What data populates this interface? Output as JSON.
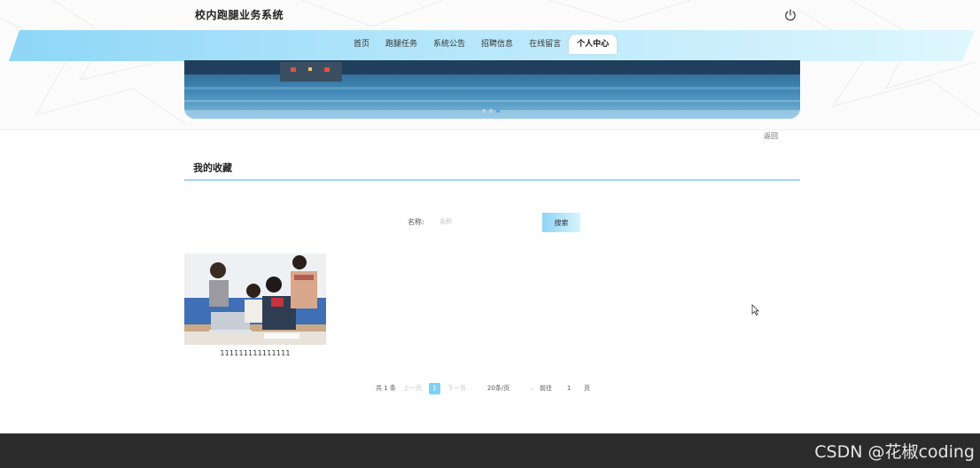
{
  "header": {
    "site_title": "校内跑腿业务系统",
    "power_icon": "power-icon"
  },
  "nav": {
    "items": [
      {
        "label": "首页"
      },
      {
        "label": "跑腿任务"
      },
      {
        "label": "系统公告"
      },
      {
        "label": "招聘信息"
      },
      {
        "label": "在线留言"
      },
      {
        "label": "个人中心",
        "active": true
      }
    ]
  },
  "banner": {
    "active_dot": 3,
    "dot_count": 3
  },
  "back_link": "返回",
  "section": {
    "title": "我的收藏"
  },
  "search": {
    "label": "名称:",
    "placeholder": "名称",
    "button": "搜索"
  },
  "favorites": [
    {
      "title": "111111111111111",
      "image": "students-with-laptop-photo"
    }
  ],
  "pagination": {
    "total": "共 1 条",
    "prev": "上一页",
    "current_page": "1",
    "next": "下一页",
    "page_size": "20条/页",
    "goto_label": "前往",
    "goto_value": "1",
    "page_unit": "页"
  },
  "watermark": "CSDN @花椒coding",
  "colors": {
    "accent": "#7fcff6",
    "nav_band": "#bfe8fb",
    "footer": "#2b2b2b"
  }
}
